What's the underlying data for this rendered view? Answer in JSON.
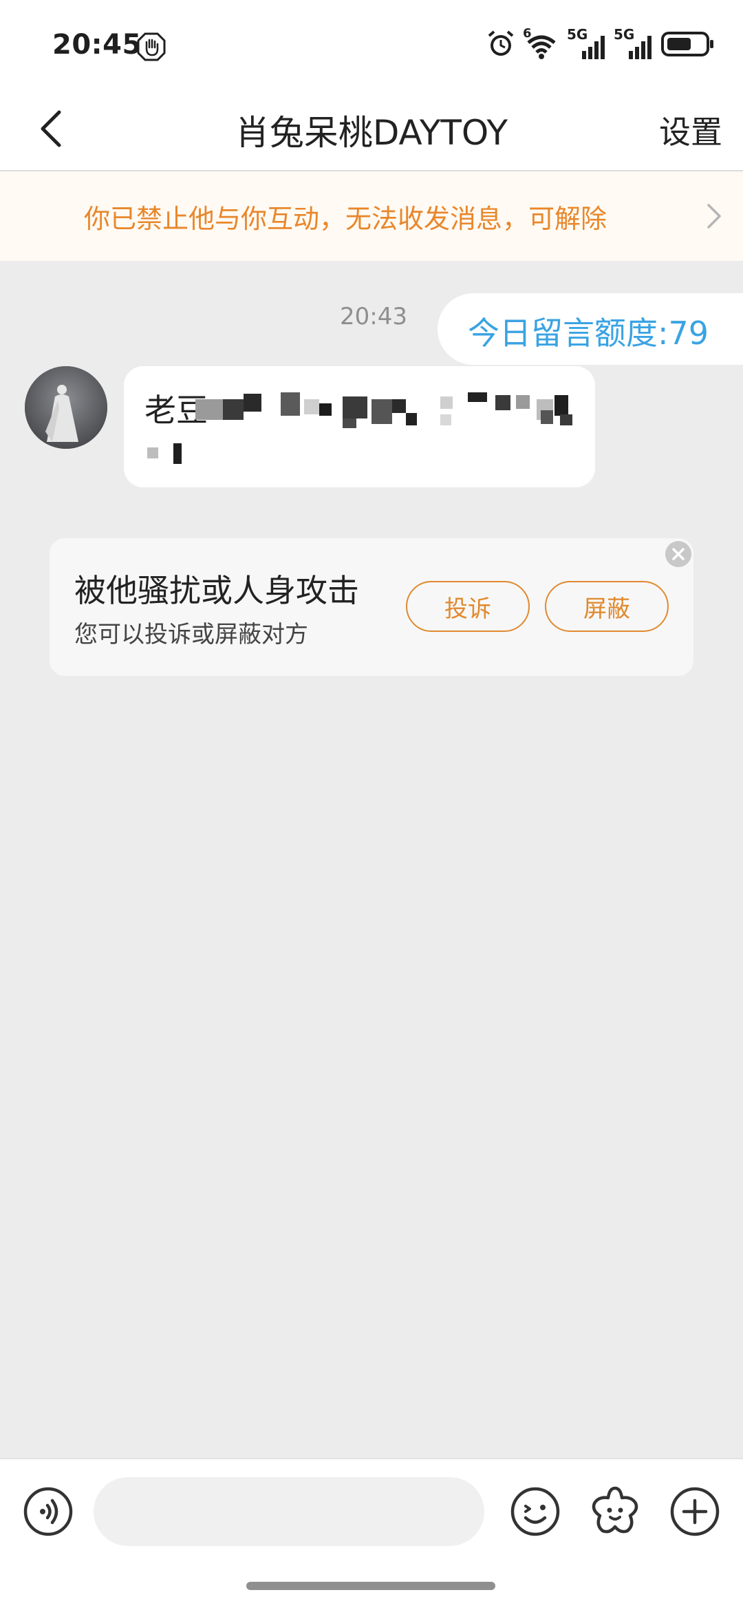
{
  "status_bar": {
    "time": "20:45",
    "icons": [
      "hand-icon",
      "alarm-icon",
      "wifi-icon",
      "signal-5g-icon",
      "signal-5g-icon",
      "battery-icon"
    ],
    "wifi_badge": "6",
    "network_label_1": "5G",
    "network_label_2": "5G"
  },
  "header": {
    "back_icon": "chevron-left-icon",
    "title": "肖兔呆桃DAYTOY",
    "settings_label": "设置"
  },
  "banner": {
    "text": "你已禁止他与你互动，无法收发消息，可解除",
    "icon": "chevron-right-icon",
    "color": "#e8872c"
  },
  "chat": {
    "timestamp": "20:43",
    "quota_text": "今日留言额度:79",
    "message": {
      "visible_prefix": "老豆",
      "redacted": true
    }
  },
  "report_card": {
    "title": "被他骚扰或人身攻击",
    "subtitle": "您可以投诉或屏蔽对方",
    "complain_label": "投诉",
    "block_label": "屏蔽",
    "close_icon": "close-icon",
    "accent": "#e0892e"
  },
  "input_bar": {
    "voice_icon": "voice-icon",
    "placeholder": "",
    "emoji_icon": "emoji-icon",
    "sticker_icon": "sticker-icon",
    "plus_icon": "plus-icon"
  },
  "colors": {
    "background": "#ececec",
    "quota_text": "#3aa3e3"
  }
}
